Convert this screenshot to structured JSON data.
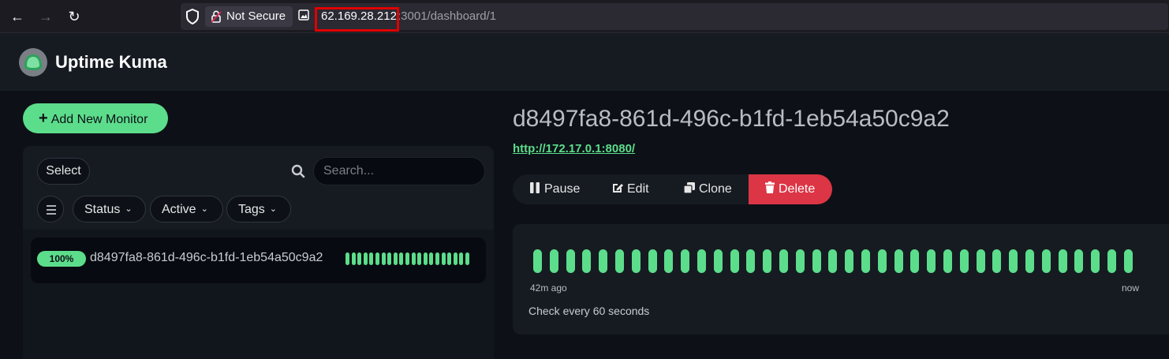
{
  "browser": {
    "not_secure_label": "Not Secure",
    "url_host": "62.169.28.212",
    "url_rest": ":3001/dashboard/1"
  },
  "app": {
    "title": "Uptime Kuma"
  },
  "sidebar": {
    "add_monitor_label": "Add New Monitor",
    "select_label": "Select",
    "search_placeholder": "Search...",
    "filters": [
      "Status",
      "Active",
      "Tags"
    ],
    "monitors": [
      {
        "uptime_badge": "100%",
        "name": "d8497fa8-861d-496c-b1fd-1eb54a50c9a2",
        "beats": 21
      }
    ]
  },
  "detail": {
    "title": "d8497fa8-861d-496c-b1fd-1eb54a50c9a2",
    "url": "http://172.17.0.1:8080/",
    "actions": {
      "pause": "Pause",
      "edit": "Edit",
      "clone": "Clone",
      "delete": "Delete"
    },
    "heartbeat": {
      "beats": 37,
      "start_label": "42m ago",
      "end_label": "now",
      "check_interval_text": "Check every 60 seconds"
    }
  },
  "colors": {
    "up_green": "#5cdd8b",
    "danger_red": "#dc3545",
    "highlight_box": "#e00000"
  }
}
